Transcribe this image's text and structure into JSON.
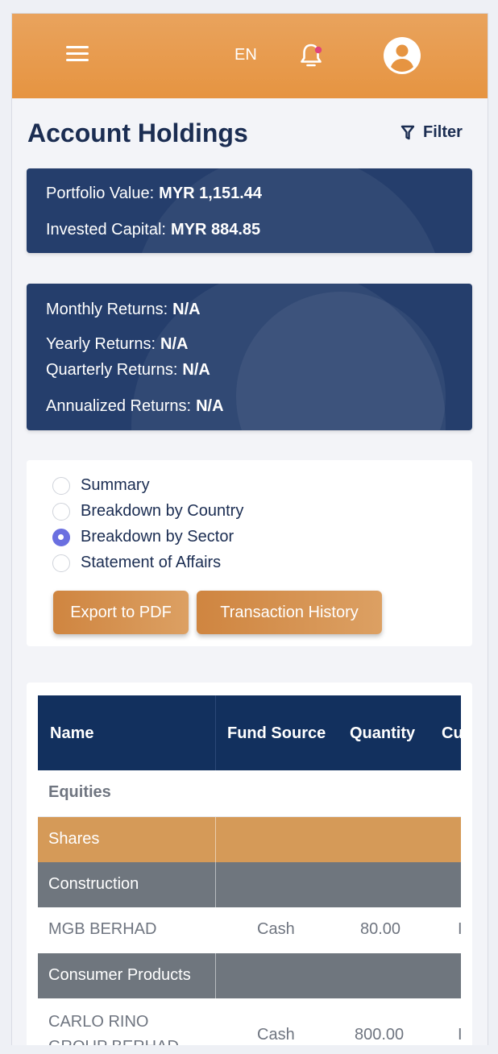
{
  "header": {
    "language": "EN",
    "icons": [
      "hamburger-menu-icon",
      "bell-icon",
      "user-avatar-icon"
    ],
    "accent_color": "#e69441",
    "notification_dot_color": "#e0447a"
  },
  "page": {
    "title": "Account Holdings",
    "filter_label": "Filter"
  },
  "portfolio": {
    "value_label": "Portfolio Value:",
    "value": "MYR 1,151.44",
    "capital_label": "Invested Capital:",
    "capital": "MYR 884.85"
  },
  "returns": {
    "monthly_label": "Monthly Returns:",
    "monthly": "N/A",
    "yearly_label": "Yearly Returns:",
    "yearly": "N/A",
    "quarterly_label": "Quarterly Returns:",
    "quarterly": "N/A",
    "annualized_label": "Annualized Returns:",
    "annualized": "N/A"
  },
  "options": {
    "radios": [
      {
        "label": "Summary",
        "checked": false
      },
      {
        "label": "Breakdown by Country",
        "checked": false
      },
      {
        "label": "Breakdown by Sector",
        "checked": true
      },
      {
        "label": "Statement of Affairs",
        "checked": false
      }
    ],
    "export_label": "Export to PDF",
    "history_label": "Transaction History"
  },
  "table": {
    "headers": [
      "Name",
      "Fund Source",
      "Quantity",
      "Cu"
    ],
    "asset_class": "Equities",
    "category": "Shares",
    "sectors": [
      {
        "name": "Construction",
        "rows": [
          {
            "name": "MGB BERHAD",
            "fund_source": "Cash",
            "quantity": "80.00"
          }
        ]
      },
      {
        "name": "Consumer Products",
        "rows": [
          {
            "name": "CARLO RINO",
            "name_line2": "GROUP BERHAD",
            "fund_source": "Cash",
            "quantity": "800.00"
          }
        ]
      }
    ]
  }
}
